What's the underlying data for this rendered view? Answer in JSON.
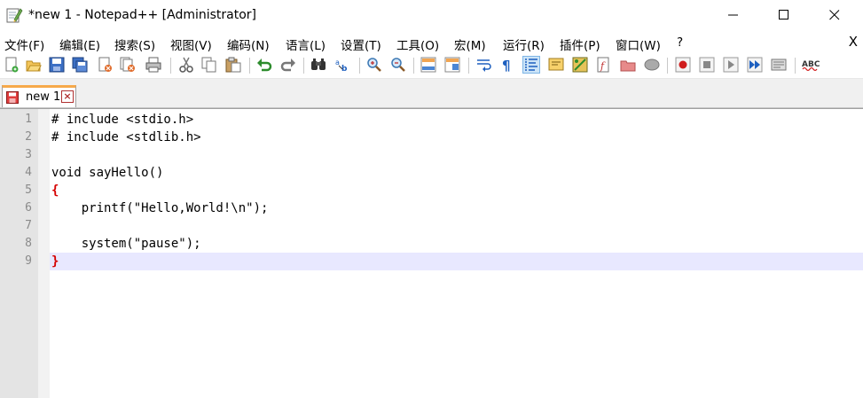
{
  "window": {
    "title": "*new 1 - Notepad++ [Administrator]",
    "app_icon": "notepad-pencil-icon",
    "controls": {
      "minimize": "—",
      "maximize": "☐",
      "close": "✕"
    }
  },
  "menu": {
    "items": [
      "文件(F)",
      "编辑(E)",
      "搜索(S)",
      "视图(V)",
      "编码(N)",
      "语言(L)",
      "设置(T)",
      "工具(O)",
      "宏(M)",
      "运行(R)",
      "插件(P)",
      "窗口(W)",
      "?"
    ],
    "close_doc": "X"
  },
  "toolbar": {
    "icons": [
      "new-file-icon",
      "open-file-icon",
      "save-icon",
      "save-all-icon",
      "close-icon",
      "close-all-icon",
      "print-icon",
      "cut-icon",
      "copy-icon",
      "paste-icon",
      "undo-icon",
      "redo-icon",
      "find-icon",
      "replace-icon",
      "zoom-in-icon",
      "zoom-out-icon",
      "sync-vertical-icon",
      "sync-horizontal-icon",
      "word-wrap-icon",
      "show-all-chars-icon",
      "indent-guide-icon",
      "doc-map-icon",
      "function-list-icon",
      "folder-as-workspace-icon",
      "monitoring-icon",
      "record-macro-icon",
      "stop-record-icon",
      "play-macro-icon",
      "run-macro-multiple-icon",
      "save-macro-icon",
      "spell-check-icon"
    ]
  },
  "tabs": [
    {
      "label": "new 1",
      "active": true
    }
  ],
  "editor": {
    "current_line": 9,
    "lines": [
      {
        "number": "1",
        "text": "# include <stdio.h>"
      },
      {
        "number": "2",
        "text": "# include <stdlib.h>"
      },
      {
        "number": "3",
        "text": ""
      },
      {
        "number": "4",
        "text": "void sayHello()"
      },
      {
        "number": "5",
        "text": "{"
      },
      {
        "number": "6",
        "text": "    printf(\"Hello,World!\\n\");"
      },
      {
        "number": "7",
        "text": ""
      },
      {
        "number": "8",
        "text": "    system(\"pause\");"
      },
      {
        "number": "9",
        "text": "}"
      }
    ]
  }
}
